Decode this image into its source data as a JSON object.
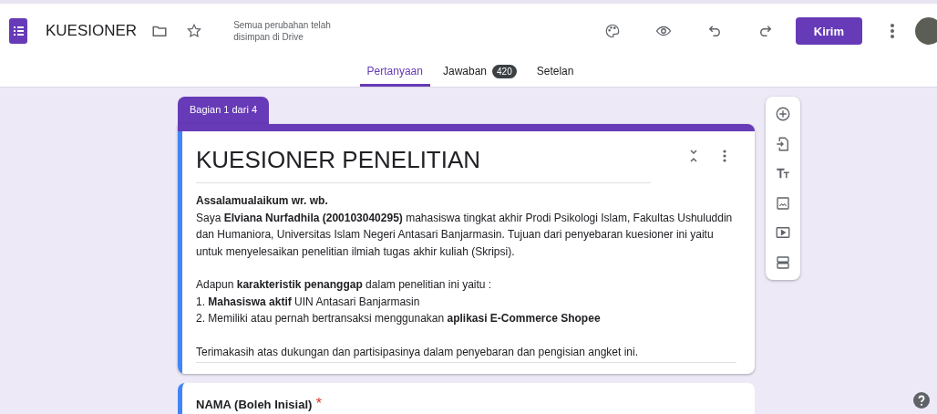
{
  "header": {
    "title": "KUESIONER",
    "save_status": "Semua perubahan telah disimpan di Drive",
    "send_button": "Kirim"
  },
  "tabs": [
    {
      "label": "Pertanyaan",
      "selected": true
    },
    {
      "label": "Jawaban",
      "selected": false,
      "badge": "420"
    },
    {
      "label": "Setelan",
      "selected": false
    }
  ],
  "section_label": "Bagian 1 dari 4",
  "form": {
    "title": "KUESIONER PENELITIAN",
    "description": [
      [
        "**Assalamualaikum wr. wb.**",
        "Saya **Elviana Nurfadhila (200103040295)** mahasiswa tingkat akhir Prodi Psikologi Islam, Fakultas Ushuluddin dan Humaniora, Universitas Islam Negeri Antasari Banjarmasin. Tujuan dari penyebaran kuesioner ini yaitu untuk menyelesaikan penelitian ilmiah tugas akhir kuliah (Skripsi)."
      ],
      [
        "Adapun **karakteristik penanggap** dalam penelitian ini yaitu :",
        "1. **Mahasiswa aktif** UIN Antasari Banjarmasin",
        "2. Memiliki atau pernah bertransaksi menggunakan **aplikasi E-Commerce Shopee**"
      ],
      [
        "Terimakasih atas dukungan dan partisipasinya dalam penyebaran dan pengisian angket ini."
      ]
    ]
  },
  "required_mark": "*",
  "questions": [
    {
      "title": "NAMA (Boleh Inisial)",
      "required": true
    }
  ]
}
